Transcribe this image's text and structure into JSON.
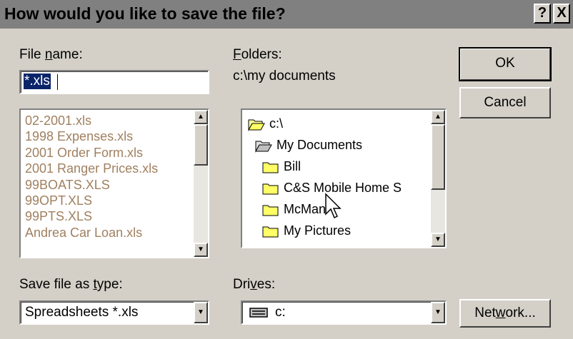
{
  "dialog": {
    "title": "How would you like to save the file?",
    "help_button": "?",
    "close_button": "X"
  },
  "filename": {
    "label_pre": "File ",
    "label_accel": "n",
    "label_post": "ame:",
    "value": "*.xls"
  },
  "folders": {
    "label_accel": "F",
    "label_post": "olders:",
    "current_path": "c:\\my documents",
    "items": [
      {
        "label": "c:\\",
        "icon": "open-folder-icon"
      },
      {
        "label": "My Documents",
        "icon": "open-folder-icon"
      },
      {
        "label": "Bill",
        "icon": "folder-icon"
      },
      {
        "label": "C&S Mobile Home S",
        "icon": "folder-icon"
      },
      {
        "label": "McMan",
        "icon": "folder-icon"
      },
      {
        "label": "My Pictures",
        "icon": "folder-icon"
      }
    ]
  },
  "files": [
    "02-2001.xls",
    "1998 Expenses.xls",
    "2001 Order Form.xls",
    "2001 Ranger Prices.xls",
    "99BOATS.XLS",
    "99OPT.XLS",
    "99PTS.XLS",
    "Andrea Car Loan.xls"
  ],
  "buttons": {
    "ok": "OK",
    "cancel": "Cancel",
    "network_pre": "Net",
    "network_accel": "w",
    "network_post": "ork..."
  },
  "save_type": {
    "label_pre": "Save file as ",
    "label_accel": "t",
    "label_post": "ype:",
    "value": "Spreadsheets *.xls"
  },
  "drives": {
    "label_pre": "Dri",
    "label_accel": "v",
    "label_post": "es:",
    "value": "c:"
  },
  "colors": {
    "titlebar": "#808080",
    "face": "#d4d0c8",
    "file_text": "#a08060"
  }
}
